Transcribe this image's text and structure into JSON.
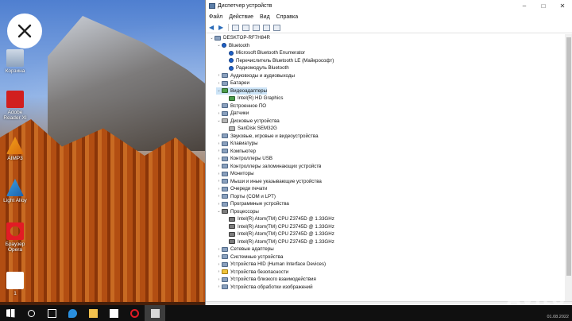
{
  "desktop": {
    "icons": [
      {
        "label": "Корзина"
      },
      {
        "label": "Adobe Reader XI"
      },
      {
        "label": "AIMP3"
      },
      {
        "label": "Light Alloy"
      },
      {
        "label": "Браузер Opera"
      },
      {
        "label": "1"
      }
    ]
  },
  "window": {
    "title": "Диспетчер устройств",
    "menu": [
      "Файл",
      "Действие",
      "Вид",
      "Справка"
    ],
    "tree": [
      {
        "label": "DESKTOP-RF7H84R",
        "level": 0,
        "toggle": "⌄",
        "icon": "computer"
      },
      {
        "label": "Bluetooth",
        "level": 1,
        "toggle": "⌄",
        "icon": "bt"
      },
      {
        "label": "Microsoft Bluetooth Enumerator",
        "level": 2,
        "toggle": "",
        "icon": "bt"
      },
      {
        "label": "Перечислитель Bluetooth LE (Майкрософт)",
        "level": 2,
        "toggle": "",
        "icon": "bt"
      },
      {
        "label": "Радиомодуль Bluetooth",
        "level": 2,
        "toggle": "",
        "icon": "bt"
      },
      {
        "label": "Аудиовходы и аудиовыходы",
        "level": 1,
        "toggle": "›",
        "icon": "dev"
      },
      {
        "label": "Батареи",
        "level": 1,
        "toggle": "›",
        "icon": "dev"
      },
      {
        "label": "Видеоадаптеры",
        "level": 1,
        "toggle": "⌄",
        "icon": "gpu",
        "selected": true
      },
      {
        "label": "Intel(R) HD Graphics",
        "level": 2,
        "toggle": "",
        "icon": "gpu"
      },
      {
        "label": "Встроенное ПО",
        "level": 1,
        "toggle": "›",
        "icon": "dev"
      },
      {
        "label": "Датчики",
        "level": 1,
        "toggle": "›",
        "icon": "dev"
      },
      {
        "label": "Дисковые устройства",
        "level": 1,
        "toggle": "⌄",
        "icon": "disk"
      },
      {
        "label": "SanDisk SEM32G",
        "level": 2,
        "toggle": "",
        "icon": "disk"
      },
      {
        "label": "Звуковые, игровые и видеоустройства",
        "level": 1,
        "toggle": "›",
        "icon": "dev"
      },
      {
        "label": "Клавиатуры",
        "level": 1,
        "toggle": "›",
        "icon": "dev"
      },
      {
        "label": "Компьютер",
        "level": 1,
        "toggle": "›",
        "icon": "dev"
      },
      {
        "label": "Контроллеры USB",
        "level": 1,
        "toggle": "›",
        "icon": "dev"
      },
      {
        "label": "Контроллеры запоминающих устройств",
        "level": 1,
        "toggle": "›",
        "icon": "dev"
      },
      {
        "label": "Мониторы",
        "level": 1,
        "toggle": "›",
        "icon": "dev"
      },
      {
        "label": "Мыши и иные указывающие устройства",
        "level": 1,
        "toggle": "›",
        "icon": "dev"
      },
      {
        "label": "Очереди печати",
        "level": 1,
        "toggle": "›",
        "icon": "dev"
      },
      {
        "label": "Порты (COM и LPT)",
        "level": 1,
        "toggle": "›",
        "icon": "dev"
      },
      {
        "label": "Программные устройства",
        "level": 1,
        "toggle": "›",
        "icon": "dev"
      },
      {
        "label": "Процессоры",
        "level": 1,
        "toggle": "⌄",
        "icon": "cpu"
      },
      {
        "label": "Intel(R) Atom(TM) CPU  Z3745D @ 1.33GHz",
        "level": 2,
        "toggle": "",
        "icon": "cpu"
      },
      {
        "label": "Intel(R) Atom(TM) CPU  Z3745D @ 1.33GHz",
        "level": 2,
        "toggle": "",
        "icon": "cpu"
      },
      {
        "label": "Intel(R) Atom(TM) CPU  Z3745D @ 1.33GHz",
        "level": 2,
        "toggle": "",
        "icon": "cpu"
      },
      {
        "label": "Intel(R) Atom(TM) CPU  Z3745D @ 1.33GHz",
        "level": 2,
        "toggle": "",
        "icon": "cpu"
      },
      {
        "label": "Сетевые адаптеры",
        "level": 1,
        "toggle": "›",
        "icon": "dev"
      },
      {
        "label": "Системные устройства",
        "level": 1,
        "toggle": "›",
        "icon": "dev"
      },
      {
        "label": "Устройства HID (Human Interface Devices)",
        "level": 1,
        "toggle": "›",
        "icon": "dev"
      },
      {
        "label": "Устройства безопасности",
        "level": 1,
        "toggle": "›",
        "icon": "warn"
      },
      {
        "label": "Устройства близкого взаимодействия",
        "level": 1,
        "toggle": "›",
        "icon": "dev"
      },
      {
        "label": "Устройства обработки изображений",
        "level": 1,
        "toggle": "›",
        "icon": "dev"
      }
    ]
  },
  "taskbar": {
    "items": [
      "start-icon",
      "search-icon",
      "task-view-icon",
      "edge-icon",
      "file-explorer-icon",
      "store-icon",
      "opera-icon",
      "device-manager-icon"
    ],
    "date": "01.08.2022"
  },
  "watermark": "Avito"
}
